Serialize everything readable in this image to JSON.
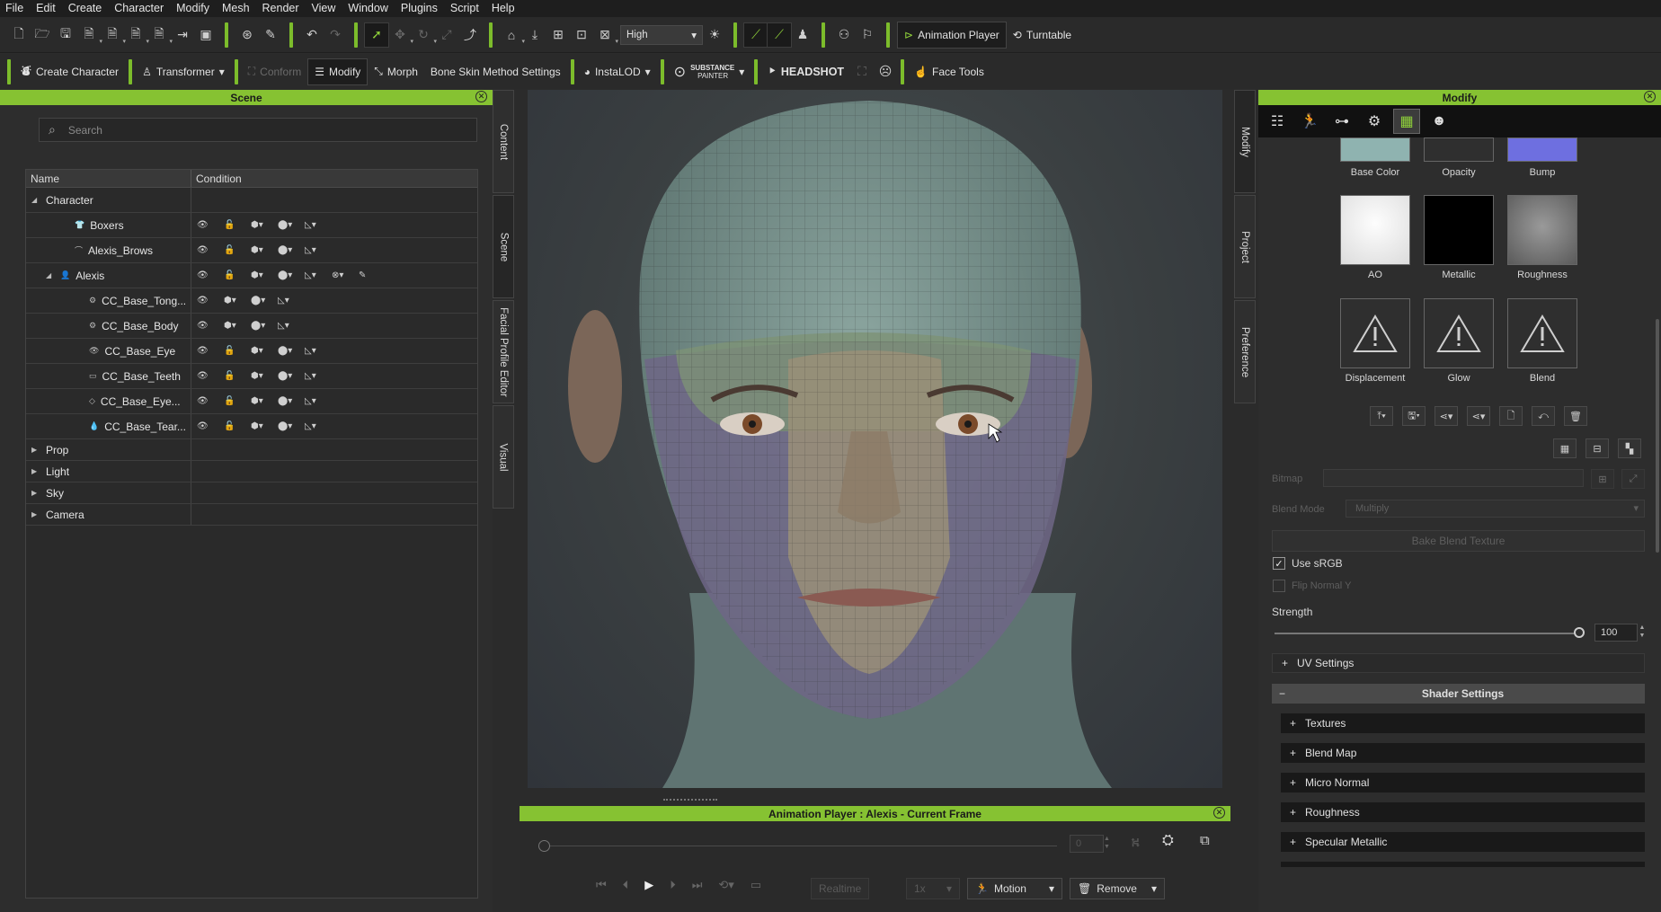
{
  "menu": [
    "File",
    "Edit",
    "Create",
    "Character",
    "Modify",
    "Mesh",
    "Render",
    "View",
    "Window",
    "Plugins",
    "Script",
    "Help"
  ],
  "toolbar1": {
    "quality": "High",
    "animation_player": "Animation Player",
    "turntable": "Turntable"
  },
  "toolbar2": {
    "create_character": "Create Character",
    "transformer": "Transformer",
    "conform": "Conform",
    "modify": "Modify",
    "morph": "Morph",
    "bone_skin": "Bone Skin Method Settings",
    "instalod": "InstaLOD",
    "substance_top": "SUBSTANCE",
    "substance_bottom": "PAINTER",
    "headshot": "HEADSHOT",
    "face_tools": "Face Tools"
  },
  "scene": {
    "title": "Scene",
    "search_placeholder": "Search",
    "col_name": "Name",
    "col_condition": "Condition",
    "rows": [
      {
        "label": "Character",
        "indent": 0,
        "arrow": "◢",
        "icon": "",
        "cond": ""
      },
      {
        "label": "Boxers",
        "indent": 2,
        "arrow": "",
        "icon": "👕",
        "cond": "full"
      },
      {
        "label": "Alexis_Brows",
        "indent": 2,
        "arrow": "",
        "icon": "⌒",
        "cond": "full"
      },
      {
        "label": "Alexis",
        "indent": 1,
        "arrow": "◢",
        "icon": "👤",
        "cond": "extra"
      },
      {
        "label": "CC_Base_Tong...",
        "indent": 3,
        "arrow": "",
        "icon": "⚙",
        "cond": "short"
      },
      {
        "label": "CC_Base_Body",
        "indent": 3,
        "arrow": "",
        "icon": "⚙",
        "cond": "short"
      },
      {
        "label": "CC_Base_Eye",
        "indent": 3,
        "arrow": "",
        "icon": "👁",
        "cond": "full"
      },
      {
        "label": "CC_Base_Teeth",
        "indent": 3,
        "arrow": "",
        "icon": "▭",
        "cond": "full"
      },
      {
        "label": "CC_Base_Eye...",
        "indent": 3,
        "arrow": "",
        "icon": "◇",
        "cond": "full"
      },
      {
        "label": "CC_Base_Tear...",
        "indent": 3,
        "arrow": "",
        "icon": "💧",
        "cond": "full"
      },
      {
        "label": "Prop",
        "indent": 0,
        "arrow": "▶",
        "icon": "",
        "cond": "",
        "small": true
      },
      {
        "label": "Light",
        "indent": 0,
        "arrow": "▶",
        "icon": "",
        "cond": "",
        "small": true
      },
      {
        "label": "Sky",
        "indent": 0,
        "arrow": "▶",
        "icon": "",
        "cond": "",
        "small": true
      },
      {
        "label": "Camera",
        "indent": 0,
        "arrow": "▶",
        "icon": "",
        "cond": "",
        "small": true
      }
    ]
  },
  "left_tabs": [
    "Content",
    "Scene",
    "Facial Profile Editor",
    "Visual"
  ],
  "right_tabs": [
    "Modify",
    "Project",
    "Preference"
  ],
  "modify": {
    "title": "Modify",
    "textures_row1": [
      "Base Color",
      "Opacity",
      "Bump"
    ],
    "textures_row2": [
      "AO",
      "Metallic",
      "Roughness"
    ],
    "textures_row3": [
      "Displacement",
      "Glow",
      "Blend"
    ],
    "bitmap_label": "Bitmap",
    "blend_mode_label": "Blend Mode",
    "blend_mode_value": "Multiply",
    "bake_button": "Bake Blend Texture",
    "use_srgb": "Use sRGB",
    "use_srgb_checked": true,
    "flip_normal": "Flip Normal Y",
    "strength_label": "Strength",
    "strength_value": "100",
    "uv_settings": "UV Settings",
    "shader_settings": "Shader Settings",
    "sections": [
      "Textures",
      "Blend Map",
      "Micro Normal",
      "Roughness",
      "Specular Metallic"
    ]
  },
  "animation": {
    "title": "Animation Player : Alexis - Current Frame",
    "frame_value": "0",
    "realtime": "Realtime",
    "speed": "1x",
    "motion": "Motion",
    "remove": "Remove"
  },
  "colors": {
    "accent": "#86c232",
    "background": "#2b2b2b",
    "header_text": "#1a1a1a"
  }
}
